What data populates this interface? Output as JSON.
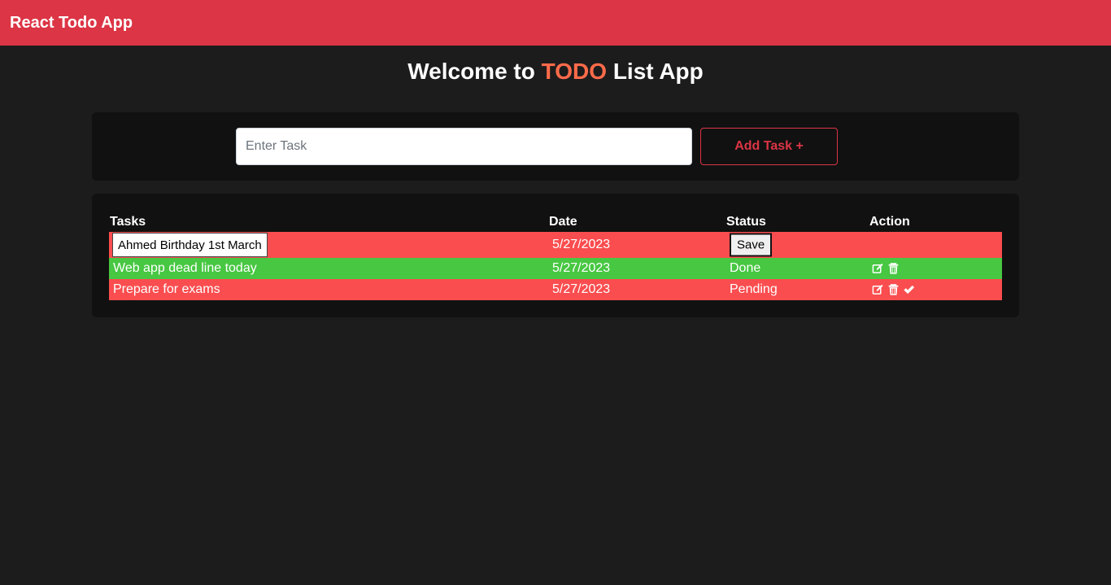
{
  "navbar": {
    "brand": "React Todo App",
    "color": "#dc3545"
  },
  "welcome": {
    "prefix": "Welcome to",
    "accent": "TODO",
    "suffix": "List App",
    "accent_color": "#ff6b4a"
  },
  "task_form": {
    "placeholder": "Enter Task",
    "add_label": "Add Task +"
  },
  "table": {
    "headers": [
      "Tasks",
      "Date",
      "Status",
      "Action"
    ],
    "rows": [
      {
        "task": "Ahmed Birthday 1st March",
        "date": "5/27/2023",
        "status": "",
        "save_label": "Save",
        "editing": true,
        "color": "#fa4d4f",
        "actions": []
      },
      {
        "task": "Web app dead line today",
        "date": "5/27/2023",
        "status": "Done",
        "editing": false,
        "color": "#47c742",
        "actions": [
          "edit-icon",
          "trash-icon"
        ]
      },
      {
        "task": "Prepare for exams",
        "date": "5/27/2023",
        "status": "Pending",
        "editing": false,
        "color": "#fa4d4f",
        "actions": [
          "edit-icon",
          "trash-icon",
          "check-icon"
        ]
      }
    ]
  }
}
